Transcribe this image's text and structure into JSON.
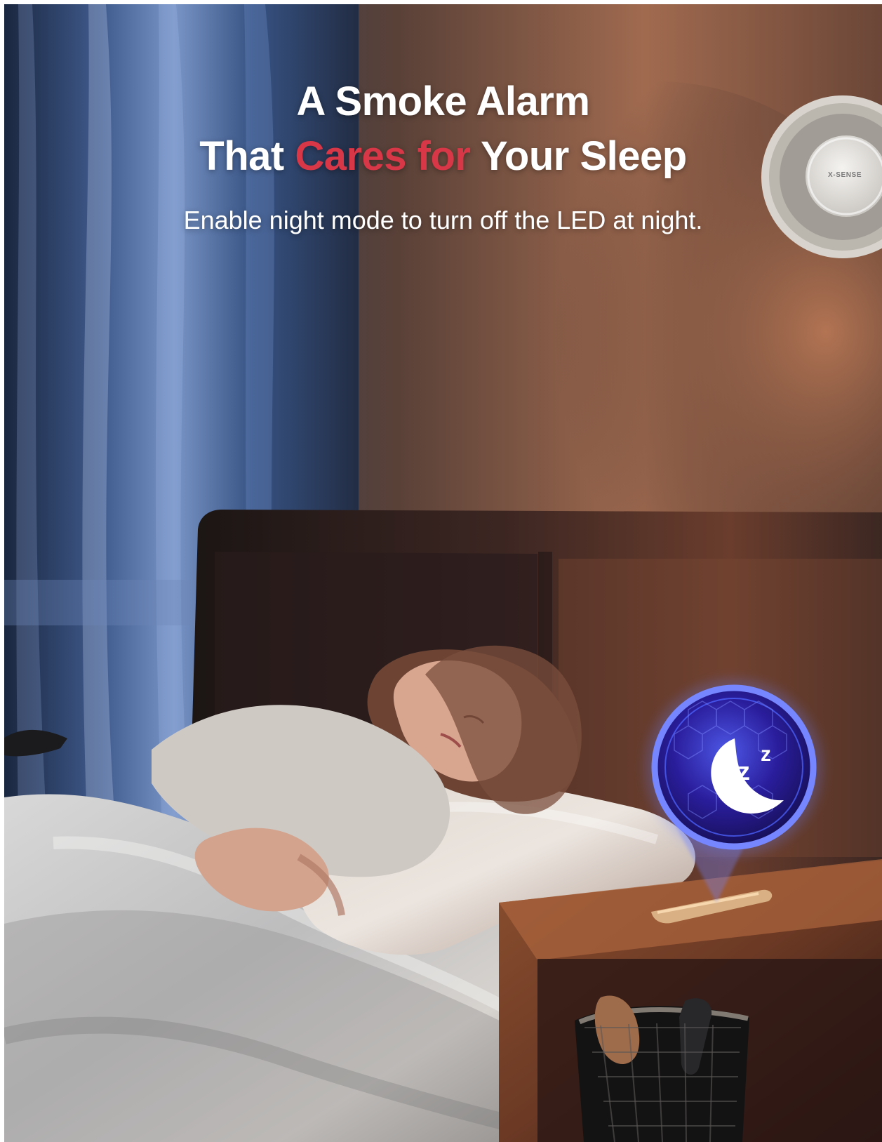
{
  "headline": {
    "line1": "A Smoke Alarm",
    "line2_prefix": "That ",
    "line2_accent": "Cares for",
    "line2_suffix": " Your Sleep"
  },
  "subheadline": "Enable night mode to turn off the LED at night.",
  "device": {
    "brand_logo": "X-SENSE"
  },
  "icons": {
    "hologram": "moon-zzz-icon"
  },
  "colors": {
    "accent": "#d83747",
    "headline": "#ffffff",
    "hologram": "#4c63ff"
  }
}
